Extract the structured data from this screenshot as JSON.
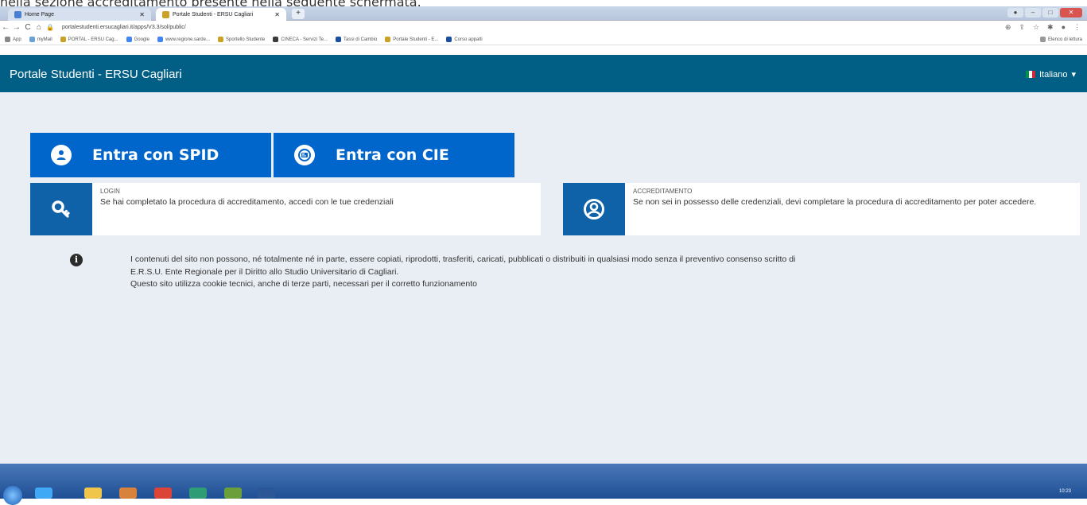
{
  "caption": "nella sezione accreditamento presente nella seguente schermata.",
  "browser": {
    "tabs": [
      {
        "title": "Home Page",
        "color": "#4a7fd4"
      },
      {
        "title": "Portale Studenti - ERSU Cagliari",
        "color": "#c9a227"
      }
    ],
    "new_tab": "+",
    "nav": {
      "back": "←",
      "forward": "→",
      "reload": "C",
      "home": "⌂"
    },
    "url": "portalestudenti.ersucagliari.it/apps/V3.3/sol/public/",
    "bookmarks": [
      {
        "label": "App",
        "color": "#888888"
      },
      {
        "label": "myMail",
        "color": "#6aa0d8"
      },
      {
        "label": "PORTAL - ERSU Cag...",
        "color": "#c9a227"
      },
      {
        "label": "Google",
        "color": "#4285f4"
      },
      {
        "label": "www.regione.sarde...",
        "color": "#4285f4"
      },
      {
        "label": "Sportello Studente",
        "color": "#c9a227"
      },
      {
        "label": "CINECA - Servizi Te...",
        "color": "#3a3a3a"
      },
      {
        "label": "Tassi di Cambio",
        "color": "#1a4fa0"
      },
      {
        "label": "Portale Studenti - E...",
        "color": "#c9a227"
      },
      {
        "label": "Corso appalti",
        "color": "#1a4fa0"
      }
    ],
    "reading_list": "Elenco di lettura"
  },
  "app": {
    "brand": "Portale Studenti - ERSU Cagliari",
    "language": "Italiano",
    "buttons": {
      "spid": "Entra con SPID",
      "cie": "Entra con CIE"
    },
    "cards": {
      "login": {
        "title": "LOGIN",
        "description": "Se hai completato la procedura di accreditamento, accedi con le tue credenziali"
      },
      "accreditamento": {
        "title": "ACCREDITAMENTO",
        "description": "Se non sei in possesso delle credenziali, devi completare la procedura di accreditamento per poter accedere."
      }
    },
    "info": {
      "line1": "I contenuti del sito non possono, né totalmente né in parte, essere copiati, riprodotti, trasferiti, caricati, pubblicati o distribuiti in qualsiasi modo senza il preventivo consenso scritto di",
      "line2": "E.R.S.U. Ente Regionale per il Diritto allo Studio Universitario di Cagliari.",
      "line3": "Questo sito utilizza cookie tecnici, anche di terze parti, necessari per il corretto funzionamento"
    }
  },
  "taskbar": {
    "clock": "10:23"
  },
  "colors": {
    "header": "#015f86",
    "button": "#0066cc",
    "card_icon": "#0f62a8",
    "background": "#e9eef4"
  }
}
